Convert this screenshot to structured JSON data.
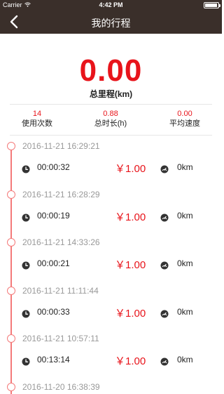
{
  "status_bar": {
    "carrier": "Carrier",
    "time": "4:42 PM"
  },
  "nav": {
    "title": "我的行程",
    "back_icon": "chevron-left-icon"
  },
  "summary": {
    "total_value": "0.00",
    "total_label": "总里程(km)"
  },
  "stats": [
    {
      "value": "14",
      "label": "使用次数"
    },
    {
      "value": "0.88",
      "label": "总时长(h)"
    },
    {
      "value": "0.00",
      "label": "平均速度"
    }
  ],
  "trips": [
    {
      "date": "2016-11-21 16:29:21",
      "duration": "00:00:32",
      "price": "￥1.00",
      "distance": "0km"
    },
    {
      "date": "2016-11-21 16:28:29",
      "duration": "00:00:19",
      "price": "￥1.00",
      "distance": "0km"
    },
    {
      "date": "2016-11-21 14:33:26",
      "duration": "00:00:21",
      "price": "￥1.00",
      "distance": "0km"
    },
    {
      "date": "2016-11-21 11:11:44",
      "duration": "00:00:33",
      "price": "￥1.00",
      "distance": "0km"
    },
    {
      "date": "2016-11-21 10:57:11",
      "duration": "00:13:14",
      "price": "￥1.00",
      "distance": "0km"
    },
    {
      "date": "2016-11-20 16:38:39"
    }
  ],
  "colors": {
    "header_bg": "#3a2f2a",
    "accent_red": "#e8141b",
    "timeline": "#f47a7a"
  }
}
